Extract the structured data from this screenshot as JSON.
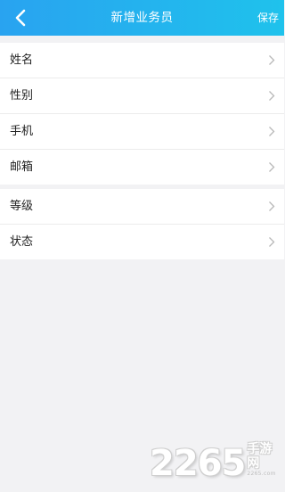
{
  "header": {
    "title": "新增业务员",
    "save_label": "保存",
    "back_icon": "chevron-left-icon"
  },
  "groups": [
    {
      "rows": [
        {
          "label": "姓名"
        },
        {
          "label": "性别"
        },
        {
          "label": "手机"
        },
        {
          "label": "邮箱"
        }
      ]
    },
    {
      "rows": [
        {
          "label": "等级"
        },
        {
          "label": "状态"
        }
      ]
    }
  ],
  "watermark": {
    "number": "2265",
    "text": "手游网",
    "sub": "2265.com"
  },
  "colors": {
    "header_start": "#29a3f0",
    "header_end": "#1fc2ec",
    "background": "#f2f2f4",
    "row_background": "#ffffff",
    "chevron": "#b8b8b8"
  }
}
